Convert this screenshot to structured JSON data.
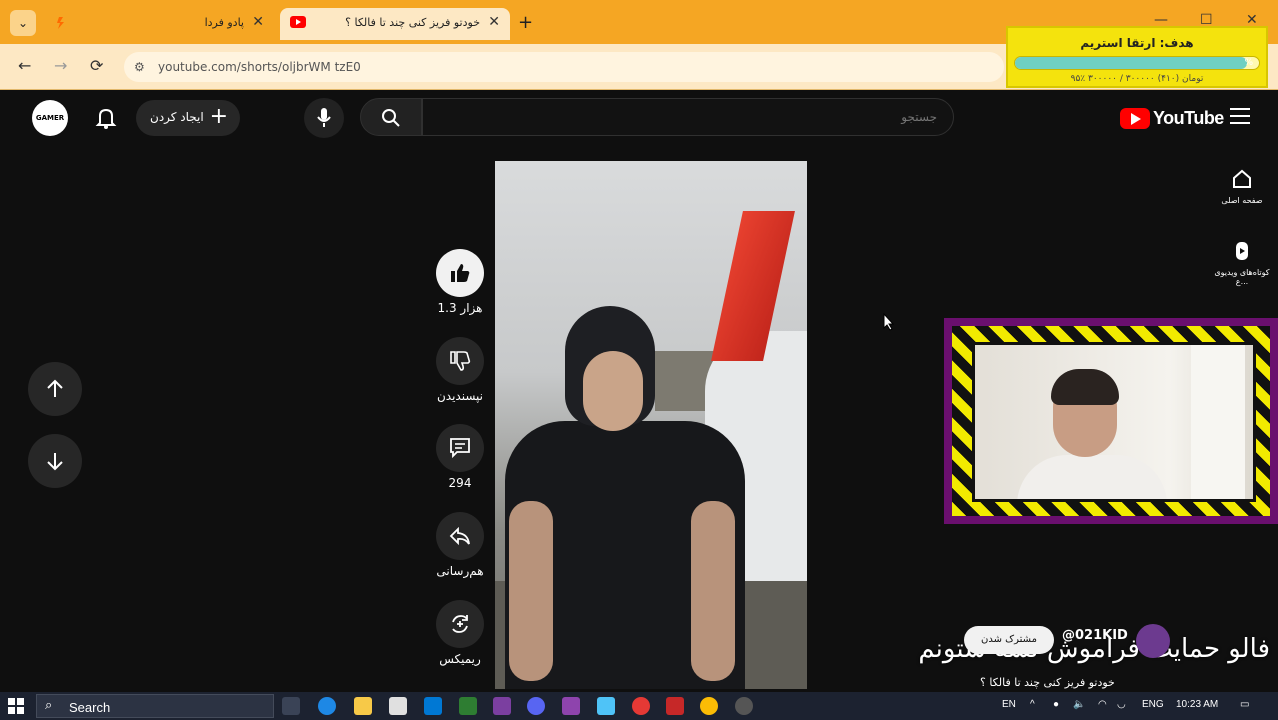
{
  "browser": {
    "tabs": [
      {
        "title": "پادو فردا"
      },
      {
        "title": "خودتو فریز کنی چند تا فالکا ؟",
        "playing": "🔊"
      }
    ],
    "new_tab_label": "+",
    "url": "youtube.com/shorts/oljbrWM tzE0"
  },
  "goal_widget": {
    "title": "هدف: ارتقا استریم",
    "progress": 0.95,
    "progress_label": "%",
    "subtitle": "۹۵٪ ۳۰۰۰۰۰ / ۳۰۰۰۰۰ تومان (۴۱۰)"
  },
  "youtube": {
    "logo_text": "YouTube",
    "search_placeholder": "جستجو",
    "create_label": "ایجاد کردن",
    "avatar_text": "GAMER",
    "nav": [
      {
        "label": "صفحه اصلی",
        "icon": "home-icon"
      },
      {
        "label": "کوتاه‌های ویدیوی ع...",
        "icon": "shorts-icon"
      }
    ]
  },
  "actions": {
    "like_count": "1.3 هزار",
    "dislike_label": "نپسندیدن",
    "comment_count": "294",
    "share_label": "هم‌رسانی",
    "remix_label": "ریمیکس"
  },
  "channel": {
    "handle": "@021KID",
    "subscribe_label": "مشترک شدن",
    "video_title": "خودتو فریز کنی چند تا فالکا ؟"
  },
  "overlay_text": "فالو  حمایت فراموش نشه ستونم",
  "taskbar": {
    "search_label": "Search",
    "lang1": "EN",
    "lang2": "ENG",
    "time": "10:23 AM"
  },
  "colors": {
    "browser_accent": "#f5a623",
    "yt_red": "#ff0000",
    "goal_yellow": "#f4e30d",
    "cam_border": "#6a0f6e"
  }
}
